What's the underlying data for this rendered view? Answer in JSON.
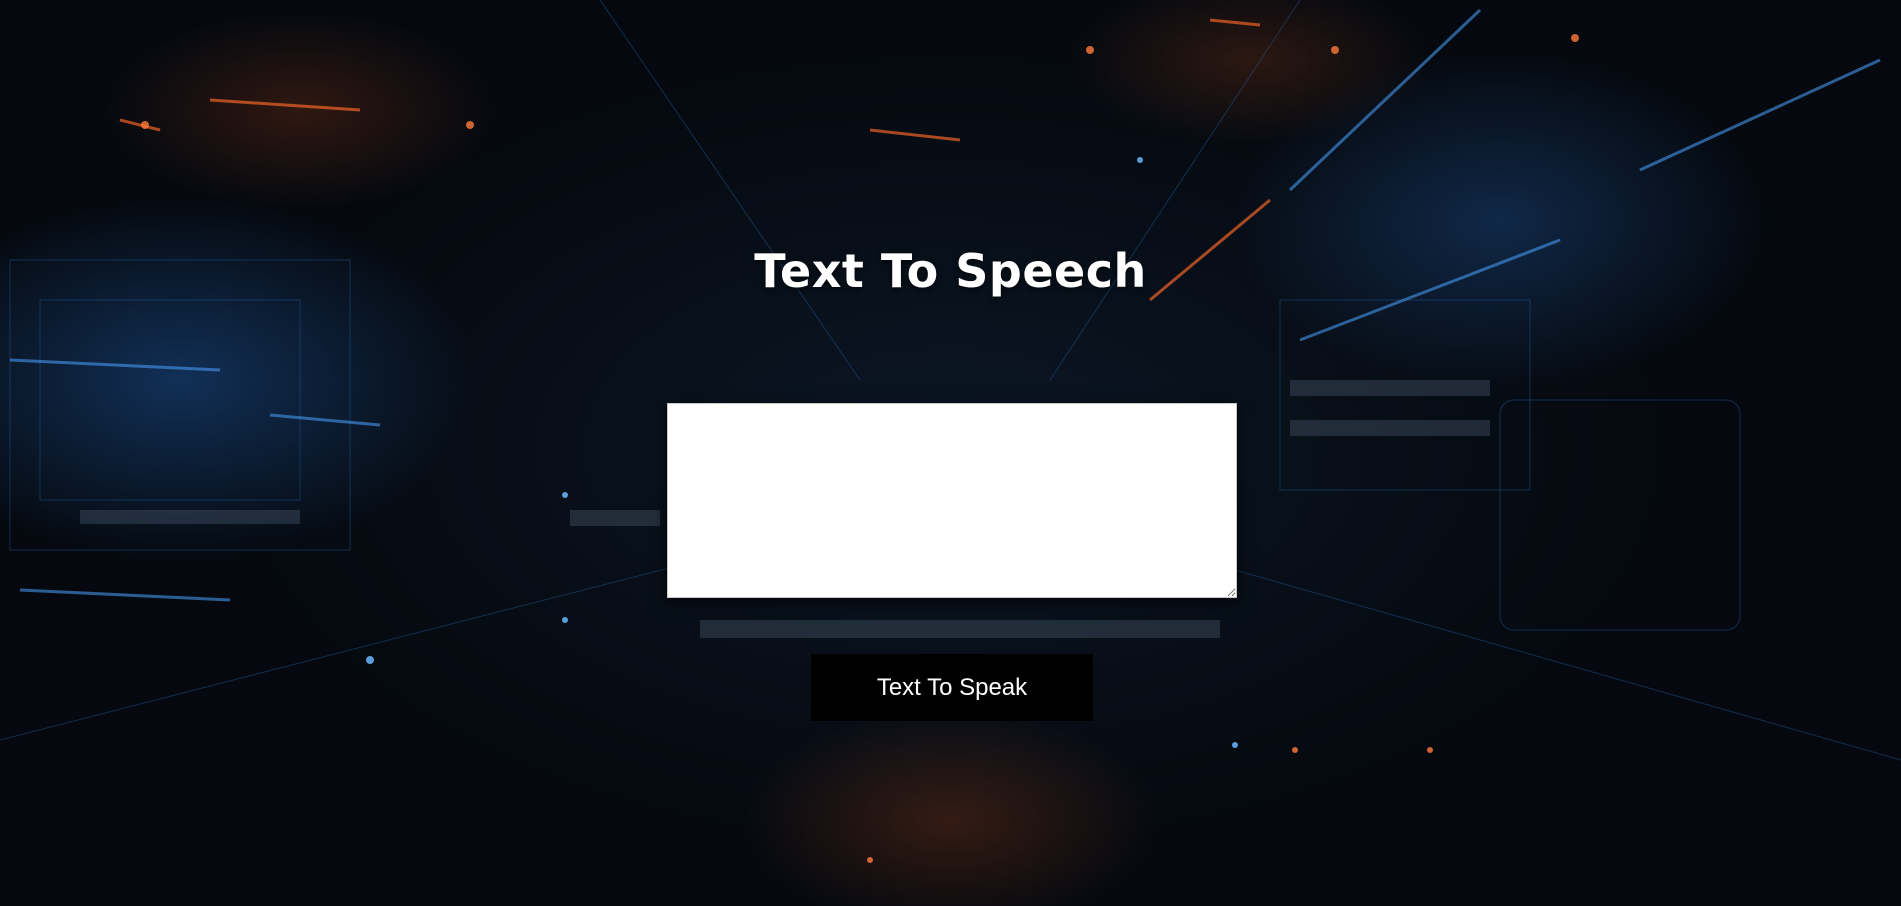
{
  "page": {
    "title": "Text To Speech"
  },
  "input": {
    "value": "",
    "placeholder": ""
  },
  "actions": {
    "speak_label": "Text To Speak"
  },
  "theme": {
    "title_color": "#ffffff",
    "button_bg": "#000000",
    "button_text": "#ffffff",
    "textarea_bg": "#ffffff"
  }
}
